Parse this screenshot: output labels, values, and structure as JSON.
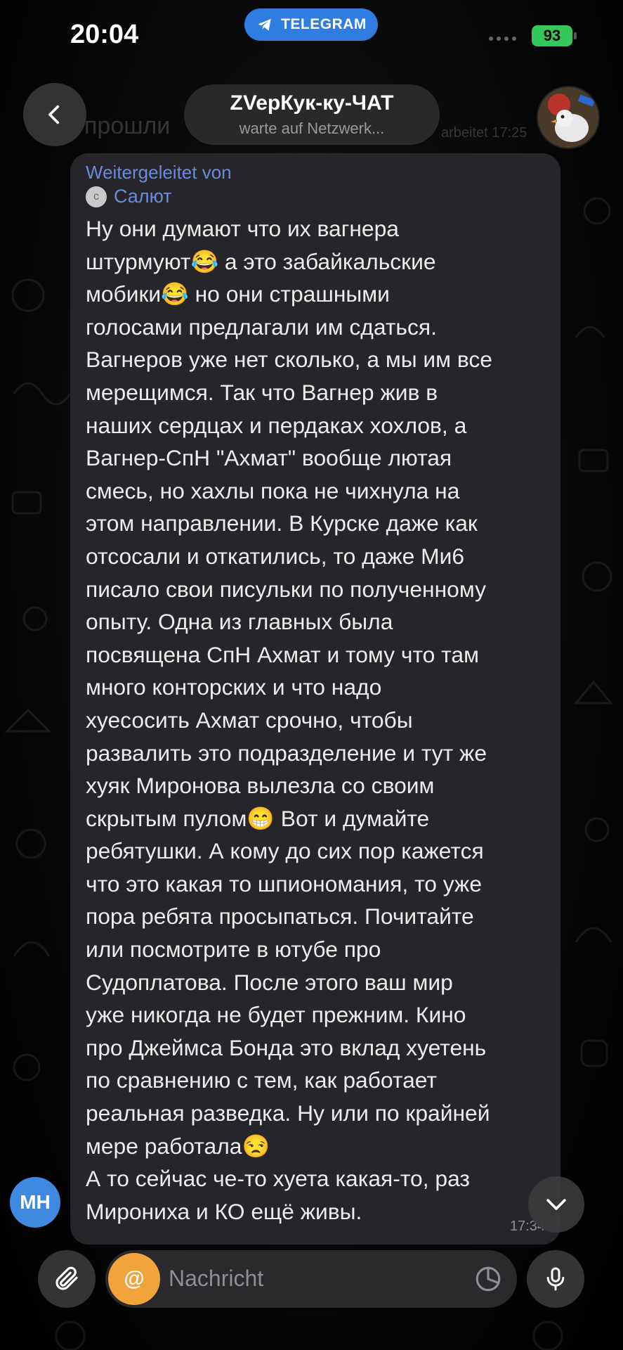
{
  "status_bar": {
    "time": "20:04",
    "battery": "93"
  },
  "app_pill": {
    "label": "TELEGRAM"
  },
  "header": {
    "title": "ZVepКук-ку-ЧАТ",
    "subtitle": "warte auf Netzwerk..."
  },
  "message": {
    "forward_label": "Weitergeleitet von",
    "forward_source": "Салют",
    "source_icon_letter": "c",
    "text": "Ну они думают что их вагнера\nштурмуют😂 а это забайкальские\nмобики😂 но они страшными\nголосами предлагали им сдаться.\nВагнеров уже нет сколько, а мы им все\nмерещимся. Так что Вагнер жив в\nнаших сердцах и пердаках хохлов, а\nВагнер-СпН \"Ахмат\" вообще лютая\nсмесь, но хахлы пока не чихнула на\nэтом направлении. В Курске даже как\nотсосали и откатились, то даже Ми6\nписало свои писульки по полученному\nопыту. Одна из главных была\nпосвящена СпН Ахмат и тому что там\nмного конторских и что надо\nхуесосить Ахмат срочно, чтобы\nразвалить это подразделение и тут же\nхуяк Миронова вылезла со своим\nскрытым пулом😁 Вот и думайте\nребятушки. А кому до сих пор кажется\nчто это какая то шпиономания, то уже\nпора ребята просыпаться. Почитайте\nили посмотрите в ютубе про\nСудоплатова. После этого ваш мир\nуже никогда не будет прежним. Кино\nпро Джеймса Бонда это вклад хуетень\nпо сравнению с тем, как работает\nреальная разведка. Ну или по крайней\nмере работала😒\nА то сейчас че-то хуета какая-то, раз\nМирониха и КО ещё живы.",
    "time": "17:34"
  },
  "user_avatar": {
    "initials": "MH"
  },
  "background_preview": {
    "text_1": "прошли",
    "text_2": "arbeitet 17:25"
  },
  "input": {
    "placeholder": "Nachricht",
    "at_symbol": "@"
  },
  "colors": {
    "accent": "#2f7de1",
    "bubble": "#26262a",
    "link": "#6a8bdc",
    "battery": "#34c759",
    "at_button": "#f2a33a"
  },
  "icons": {
    "back": "chevron-left-icon",
    "scroll": "chevron-down-icon",
    "attach": "paperclip-icon",
    "sticker": "sticker-icon",
    "mic": "microphone-icon",
    "telegram": "telegram-icon"
  }
}
